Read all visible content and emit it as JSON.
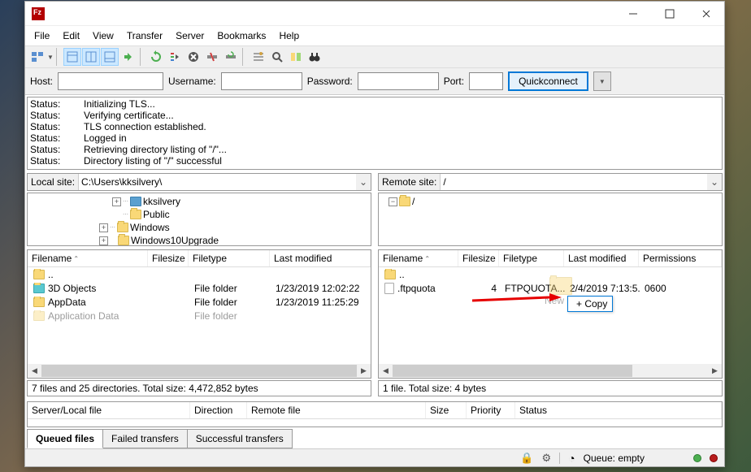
{
  "menubar": [
    "File",
    "Edit",
    "View",
    "Transfer",
    "Server",
    "Bookmarks",
    "Help"
  ],
  "quickconnect": {
    "host_label": "Host:",
    "username_label": "Username:",
    "password_label": "Password:",
    "port_label": "Port:",
    "button": "Quickconnect"
  },
  "log": [
    {
      "st": "Status:",
      "msg": "Initializing TLS..."
    },
    {
      "st": "Status:",
      "msg": "Verifying certificate..."
    },
    {
      "st": "Status:",
      "msg": "TLS connection established."
    },
    {
      "st": "Status:",
      "msg": "Logged in"
    },
    {
      "st": "Status:",
      "msg": "Retrieving directory listing of \"/\"..."
    },
    {
      "st": "Status:",
      "msg": "Directory listing of \"/\" successful"
    }
  ],
  "local": {
    "label": "Local site:",
    "path": "C:\\Users\\kksilvery\\",
    "tree": [
      {
        "indent": 104,
        "expand": "+",
        "dots": true,
        "icon": "user",
        "label": "kksilvery"
      },
      {
        "indent": 104,
        "expand": "",
        "dots": true,
        "icon": "folder",
        "label": "Public"
      },
      {
        "indent": 88,
        "expand": "+",
        "dots": true,
        "icon": "folder",
        "label": "Windows"
      },
      {
        "indent": 88,
        "expand": "+",
        "dots": false,
        "icon": "folder",
        "label": "Windows10Upgrade"
      }
    ],
    "cols": {
      "filename": "Filename",
      "filesize": "Filesize",
      "filetype": "Filetype",
      "modified": "Last modified"
    },
    "rows": [
      {
        "icon": "folder",
        "name": "..",
        "size": "",
        "type": "",
        "mod": ""
      },
      {
        "icon": "3d",
        "name": "3D Objects",
        "size": "",
        "type": "File folder",
        "mod": "1/23/2019 12:02:22"
      },
      {
        "icon": "folder",
        "name": "AppData",
        "size": "",
        "type": "File folder",
        "mod": "1/23/2019 11:25:29"
      },
      {
        "icon": "folder",
        "name": "Application Data",
        "size": "",
        "type": "File folder",
        "mod": ""
      }
    ],
    "status": "7 files and 25 directories. Total size: 4,472,852 bytes"
  },
  "remote": {
    "label": "Remote site:",
    "path": "/",
    "tree": [
      {
        "indent": 12,
        "expand": "-",
        "icon": "folder",
        "label": "/"
      }
    ],
    "cols": {
      "filename": "Filename",
      "filesize": "Filesize",
      "filetype": "Filetype",
      "modified": "Last modified",
      "perm": "Permissions"
    },
    "rows": [
      {
        "icon": "folder",
        "name": "..",
        "size": "",
        "type": "",
        "mod": "",
        "perm": ""
      },
      {
        "icon": "file",
        "name": ".ftpquota",
        "size": "4",
        "type": "FTPQUOTA...",
        "mod": "2/4/2019 7:13:5...",
        "perm": "0600"
      }
    ],
    "status": "1 file. Total size: 4 bytes",
    "tooltip": "+ Copy",
    "drag_label": "New"
  },
  "queue": {
    "cols": {
      "server": "Server/Local file",
      "direction": "Direction",
      "remote": "Remote file",
      "size": "Size",
      "priority": "Priority",
      "status": "Status"
    }
  },
  "tabs": {
    "queued": "Queued files",
    "failed": "Failed transfers",
    "success": "Successful transfers"
  },
  "statusbar": {
    "queue": "Queue: empty"
  }
}
